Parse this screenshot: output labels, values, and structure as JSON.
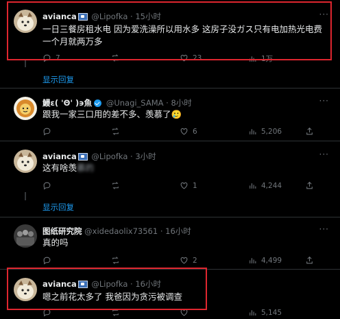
{
  "tweets": [
    {
      "name": "avianca",
      "handle": "@Lipofka",
      "time": "15小时",
      "text": "一日三餐房租水电 因为爱洗澡所以用水多 这房子没ガス只有电加热光电费一个月就两万多",
      "replies": "7",
      "retweets": "",
      "likes": "23",
      "views": "1万"
    },
    {
      "show_replies": "显示回复"
    },
    {
      "name": "鰻ε( 'Θ' )϶魚",
      "handle": "@Unagi_SAMA",
      "time": "8小时",
      "text": "跟我一家三口用的差不多、羡慕了🥲",
      "replies": "",
      "retweets": "",
      "likes": "6",
      "views": "5,206"
    },
    {
      "name": "avianca",
      "handle": "@Lipofka",
      "time": "3小时",
      "text": "这有啥羡",
      "text_blurred": "慕的",
      "replies": "",
      "retweets": "",
      "likes": "1",
      "views": "4,244"
    },
    {
      "show_replies": "显示回复"
    },
    {
      "name": "图纸研究院",
      "handle": "@xidedaolix73561",
      "time": "16小时",
      "text": "真的吗",
      "replies": "",
      "retweets": "",
      "likes": "2",
      "views": "4,499"
    },
    {
      "name": "avianca",
      "handle": "@Lipofka",
      "time": "16小时",
      "text": "嗯之前花太多了 我爸因为贪污被调查",
      "replies": "",
      "retweets": "",
      "likes": "",
      "views": "5,145"
    }
  ],
  "separator_dot": "·",
  "more_label": "···",
  "colors": {
    "accent": "#1d9bf0",
    "highlight": "#e0262f",
    "background": "#000000"
  }
}
